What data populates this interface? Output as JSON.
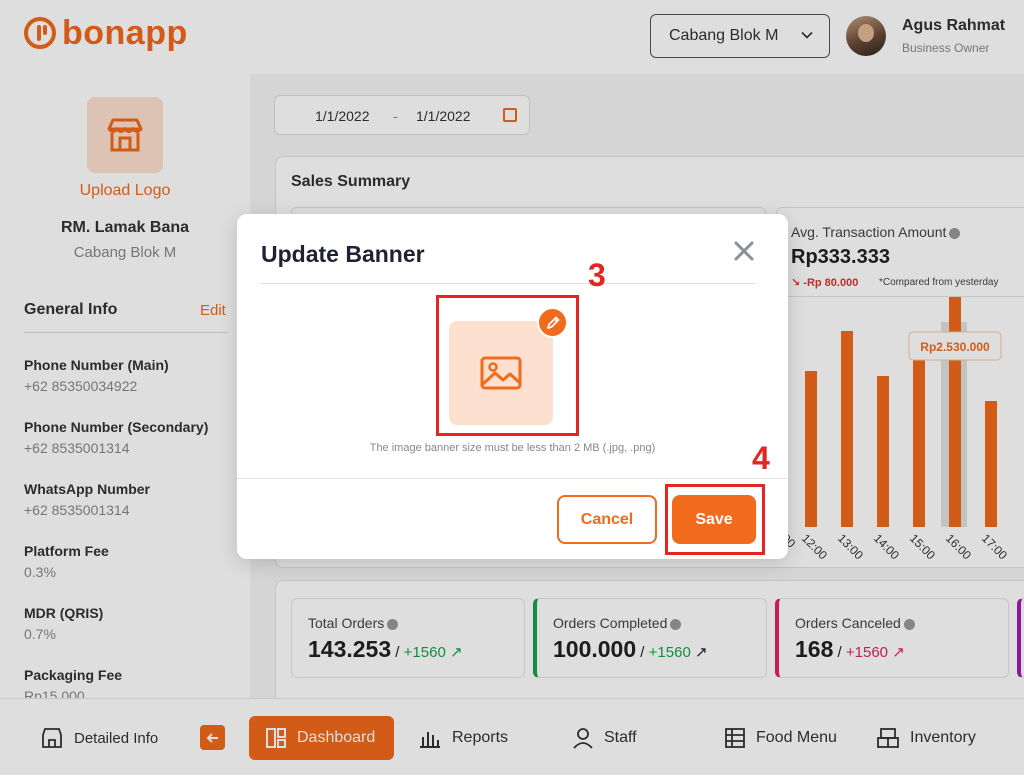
{
  "header": {
    "brand": "bonapp",
    "branch": "Cabang Blok M",
    "user_name": "Agus Rahmat",
    "user_role": "Business Owner"
  },
  "left": {
    "upload_logo": "Upload Logo",
    "store_name": "RM. Lamak Bana",
    "store_branch": "Cabang Blok M",
    "general_title": "General Info",
    "edit_label": "Edit",
    "items": [
      {
        "label": "Phone Number (Main)",
        "value": "+62 85350034922"
      },
      {
        "label": "Phone Number (Secondary)",
        "value": "+62 8535001314"
      },
      {
        "label": "WhatsApp Number",
        "value": "+62 8535001314"
      },
      {
        "label": "Platform Fee",
        "value": "0.3%"
      },
      {
        "label": "MDR (QRIS)",
        "value": "0.7%"
      },
      {
        "label": "Packaging Fee",
        "value": "Rp15.000"
      }
    ]
  },
  "date_range": {
    "start": "1/1/2022",
    "separator": "-",
    "end": "1/1/2022"
  },
  "sales": {
    "title": "Sales Summary",
    "avg_label": "Avg. Transaction Amount",
    "avg_value": "Rp333.333",
    "avg_delta": "-Rp 80.000",
    "avg_note": "*Compared from yesterday"
  },
  "chart_data": {
    "type": "bar",
    "categories": [
      "12:00",
      "13:00",
      "14:00",
      "15:00",
      "16:00",
      "17:00"
    ],
    "values": [
      1560000,
      1960000,
      1510000,
      1690000,
      2530000,
      1260000
    ],
    "highlight_index": 4,
    "highlight_label": "Rp2.530.000",
    "visible_partial_tick": "00",
    "ylim": [
      0,
      3000000
    ],
    "colors": {
      "bar": "#f26a1b",
      "highlight_band": "#e0e0e0"
    }
  },
  "stats": [
    {
      "label": "Total Orders",
      "value": "143.253",
      "delta": "+1560",
      "accent": ""
    },
    {
      "label": "Orders Completed",
      "value": "100.000",
      "delta": "+1560",
      "accent": "#17a34a"
    },
    {
      "label": "Orders Canceled",
      "value": "168",
      "delta": "+1560",
      "accent": "#e0245e"
    }
  ],
  "nav": {
    "detailed_info": "Detailed Info",
    "dashboard": "Dashboard",
    "reports": "Reports",
    "staff": "Staff",
    "food_menu": "Food Menu",
    "inventory": "Inventory"
  },
  "modal": {
    "title": "Update Banner",
    "hint": "The image banner size must be less than 2 MB (.jpg, .png)",
    "cancel": "Cancel",
    "save": "Save"
  },
  "annotations": {
    "step_banner": "3",
    "step_save": "4"
  },
  "colors": {
    "brand": "#f26a1b",
    "annotation": "#e52424",
    "positive": "#17a34a",
    "negative": "#e0245e"
  }
}
